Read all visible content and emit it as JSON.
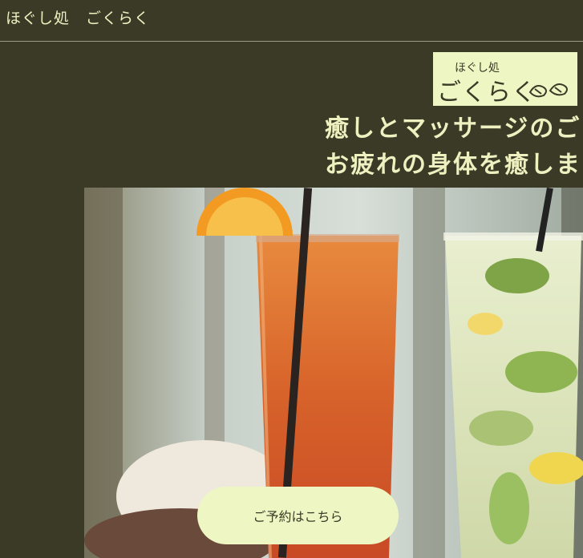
{
  "header": {
    "site_title": "ほぐし処　ごくらく"
  },
  "logo": {
    "small_text": "ほぐし処",
    "big_text": "ごくらく",
    "icon": "sandals-icon"
  },
  "hero": {
    "headline_line1": "癒しとマッサージのご",
    "headline_line2": "お疲れの身体を癒しま",
    "image": "cocktail-drinks-photo"
  },
  "cta": {
    "label": "ご予約はこちら"
  },
  "colors": {
    "background": "#3b3a27",
    "accent": "#eef7c4",
    "text": "#eef0c0"
  }
}
